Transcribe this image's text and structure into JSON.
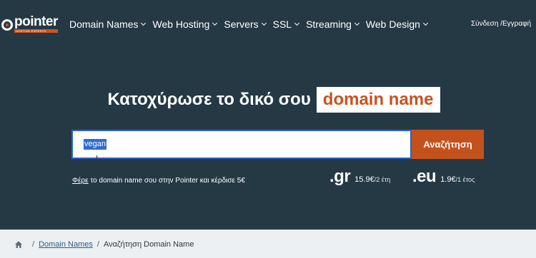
{
  "logo": {
    "text": "pointer",
    "tagline": "HOSTING EXPERTS"
  },
  "nav": {
    "items": [
      {
        "label": "Domain Names"
      },
      {
        "label": "Web Hosting"
      },
      {
        "label": "Servers"
      },
      {
        "label": "SSL"
      },
      {
        "label": "Streaming"
      },
      {
        "label": "Web Design"
      }
    ],
    "account": "Σύνδεση /Εγγραφή"
  },
  "hero": {
    "title": "Κατοχύρωσε το δικό σου",
    "highlight": "domain name"
  },
  "search": {
    "value": "vegan",
    "button": "Αναζήτηση"
  },
  "promo": {
    "link": "Φέρε",
    "text": " το domain name σου στην Pointer και κέρδισε 5€"
  },
  "tlds": [
    {
      "name": ".gr",
      "price": "15.9€",
      "period": "/2 έτη"
    },
    {
      "name": ".eu",
      "price": "1.9€",
      "period": "/1 έτος"
    }
  ],
  "breadcrumb": {
    "link": "Domain Names",
    "current": "Αναζήτηση Domain Name"
  },
  "colors": {
    "background": "#253945",
    "accent": "#c4511c",
    "selection": "#2f6cd1"
  }
}
